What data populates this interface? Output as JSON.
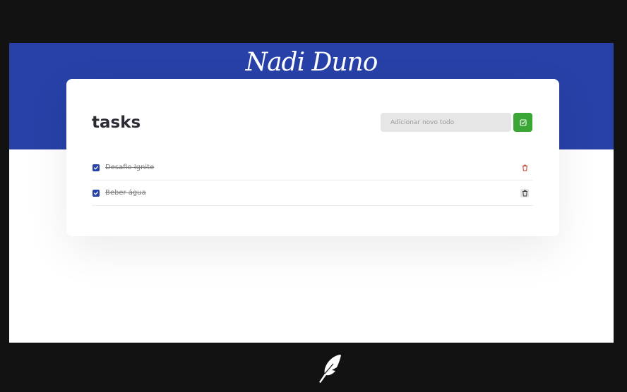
{
  "app": {
    "brand": "Nadi Duno"
  },
  "card": {
    "title": "tasks"
  },
  "new_todo": {
    "placeholder": "Adicionar novo todo",
    "value": ""
  },
  "tasks": [
    {
      "label": "Desafio Ignite",
      "completed": true
    },
    {
      "label": "Beber água",
      "completed": true
    }
  ],
  "colors": {
    "header": "#2741a8",
    "add_button": "#3aa635",
    "trash": "#c0392b",
    "checkbox": "#2741a8"
  },
  "icons": {
    "add": "check-square-icon",
    "delete": "trash-icon",
    "checked": "checkmark-icon",
    "footer": "quill-icon"
  }
}
